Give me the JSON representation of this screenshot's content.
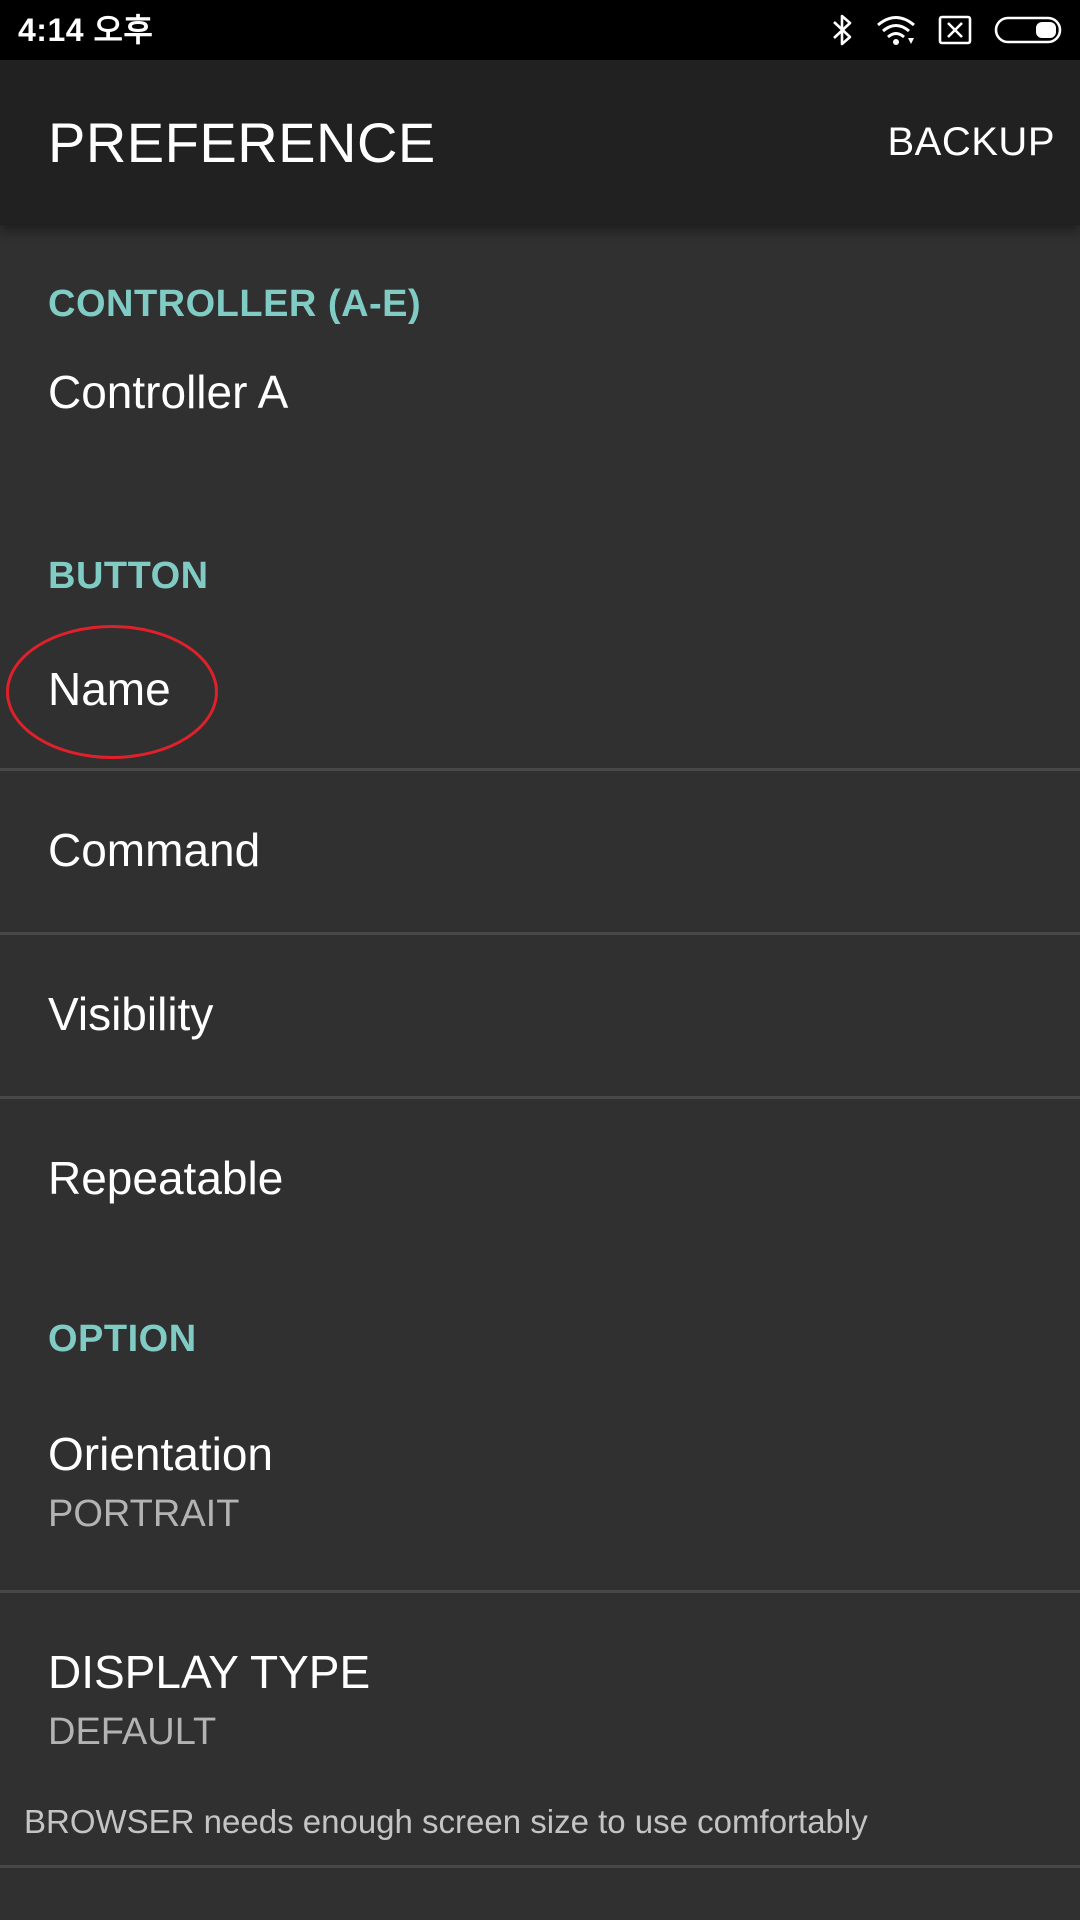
{
  "status_bar": {
    "time": "4:14 오후",
    "icons": [
      "bluetooth-icon",
      "wifi-icon",
      "no-sim-icon",
      "battery-icon"
    ]
  },
  "toolbar": {
    "title": "PREFERENCE",
    "action_label": "BACKUP"
  },
  "sections": {
    "controller": {
      "header": "CONTROLLER (A-E)",
      "items": [
        {
          "title": "Controller A"
        }
      ]
    },
    "button": {
      "header": "BUTTON",
      "items": [
        {
          "title": "Name"
        },
        {
          "title": "Command"
        },
        {
          "title": "Visibility"
        },
        {
          "title": "Repeatable"
        }
      ]
    },
    "option": {
      "header": "OPTION",
      "items": [
        {
          "title": "Orientation",
          "summary": "PORTRAIT"
        },
        {
          "title": "DISPLAY TYPE",
          "summary": "DEFAULT"
        }
      ],
      "footnote": "BROWSER needs enough screen size to use comfortably"
    }
  },
  "colors": {
    "accent": "#80cbc4",
    "background": "#303030",
    "toolbar": "#212121",
    "annotation": "#e0202a"
  }
}
